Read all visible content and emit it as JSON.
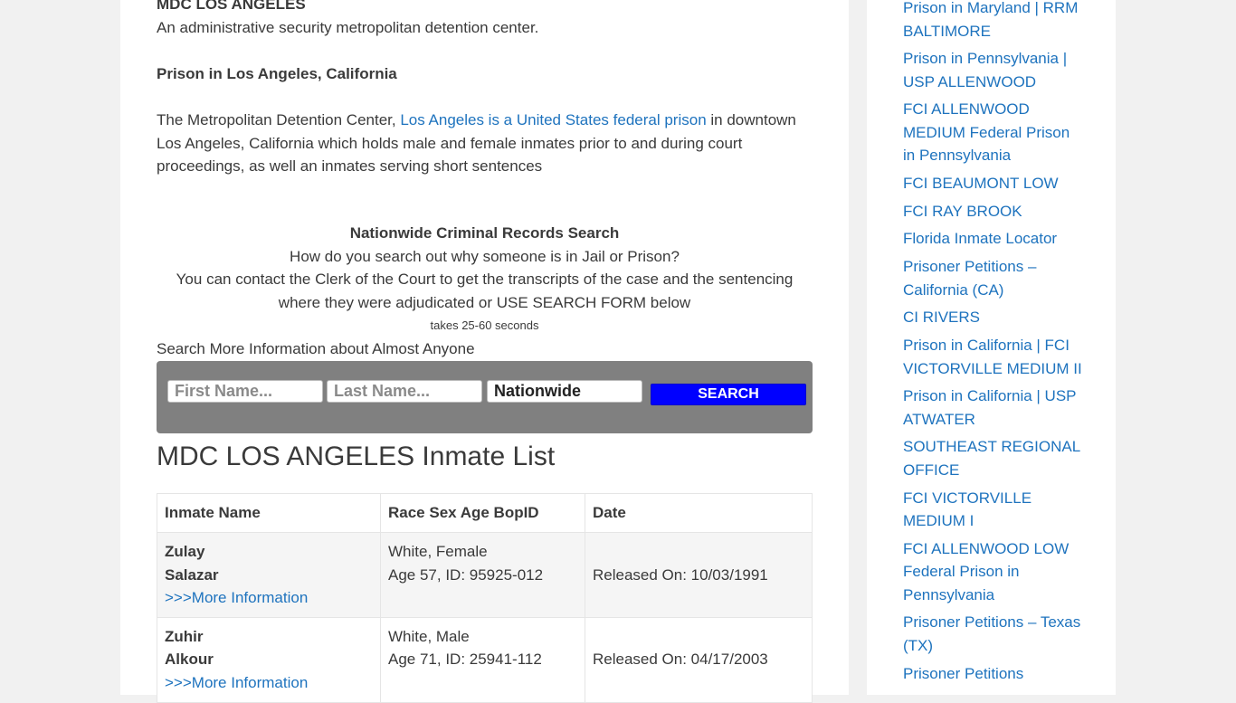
{
  "article": {
    "top_heading": "MDC LOS ANGELES",
    "description": "An administrative security metropolitan detention center.",
    "location_heading": "Prison in Los Angeles, California",
    "paragraph_prefix": "The Metropolitan Detention Center, ",
    "paragraph_link": "Los Angeles is a United States federal prison",
    "paragraph_suffix": " in downtown Los Angeles, California which holds male and female inmates prior to and during court proceedings, as well an inmates serving short sentences"
  },
  "records_search": {
    "heading": "Nationwide Criminal Records Search",
    "question": "How do you search out why someone is in Jail or Prison?",
    "instructions": "You can contact the Clerk of the Court to get the transcripts of the case and the sentencing where they were adjudicated or USE SEARCH FORM below",
    "timing_note": "takes 25-60 seconds",
    "more_info_label": "Search More Information about Almost Anyone"
  },
  "search_form": {
    "first_name_placeholder": "First Name...",
    "last_name_placeholder": "Last Name...",
    "state_value": "Nationwide",
    "search_button": "SEARCH",
    "button_color": "#0000ff",
    "panel_color": "#808080"
  },
  "inmate_list": {
    "title": "MDC LOS ANGELES Inmate List",
    "columns": [
      "Inmate Name",
      "Race Sex Age BopID",
      "Date"
    ],
    "rows": [
      {
        "first_name": "Zulay",
        "last_name": "Salazar",
        "more_link": ">>>More Information",
        "race_sex": "White, Female",
        "age_id": "Age 57, ID: 95925-012",
        "date": "Released On: 10/03/1991"
      },
      {
        "first_name": "Zuhir",
        "last_name": "Alkour",
        "more_link": ">>>More Information",
        "race_sex": "White, Male",
        "age_id": "Age 71, ID: 25941-112",
        "date": "Released On: 04/17/2003"
      }
    ]
  },
  "sidebar": {
    "links": [
      "Prison in Maryland | RRM BALTIMORE",
      "Prison in Pennsylvania | USP ALLENWOOD",
      "FCI ALLENWOOD MEDIUM Federal Prison in Pennsylvania",
      "FCI BEAUMONT LOW",
      "FCI RAY BROOK",
      "Florida Inmate Locator",
      "Prisoner Petitions – California (CA)",
      "CI RIVERS",
      "Prison in California | FCI VICTORVILLE MEDIUM II",
      "Prison in California | USP ATWATER",
      "SOUTHEAST REGIONAL OFFICE",
      "FCI VICTORVILLE MEDIUM I",
      "FCI ALLENWOOD LOW Federal Prison in Pennsylvania",
      "Prisoner Petitions – Texas (TX)",
      "Prisoner Petitions"
    ],
    "link_color": "#1e73be"
  }
}
